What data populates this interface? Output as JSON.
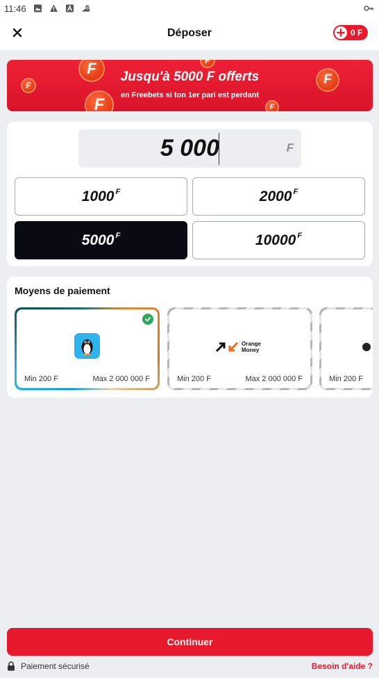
{
  "status_bar": {
    "time": "11:46",
    "icons": [
      "image-icon",
      "warning-icon",
      "font-icon",
      "signal-check-icon"
    ],
    "right_icon": "key-icon"
  },
  "header": {
    "title": "Déposer",
    "close_icon": "close-icon",
    "balance": "0 F"
  },
  "promo": {
    "title": "Jusqu'à 5000 F offerts",
    "subtitle": "en Freebets si ton 1er pari est perdant",
    "coin_letter": "F"
  },
  "amount": {
    "value": "5 000",
    "currency": "F",
    "presets": [
      {
        "value": "1000",
        "unit": "F",
        "selected": false
      },
      {
        "value": "2000",
        "unit": "F",
        "selected": false
      },
      {
        "value": "5000",
        "unit": "F",
        "selected": true
      },
      {
        "value": "10000",
        "unit": "F",
        "selected": false
      }
    ]
  },
  "payment": {
    "title": "Moyens de paiement",
    "methods": [
      {
        "name": "penguin-wallet",
        "min": "Min 200 F",
        "max": "Max 2 000 000 F",
        "selected": true
      },
      {
        "name": "Orange Money",
        "logo_line1": "Orange",
        "logo_line2": "Money",
        "min": "Min 200 F",
        "max": "Max 2 000 000 F",
        "selected": false
      },
      {
        "name": "third-method",
        "min": "Min 200 F",
        "selected": false
      }
    ]
  },
  "actions": {
    "continue": "Continuer",
    "secure": "Paiement sécurisé",
    "help": "Besoin d'aide ?"
  },
  "colors": {
    "brand_red": "#e8192c",
    "selected_dark": "#0a0a14",
    "check_green": "#2ea65c"
  }
}
